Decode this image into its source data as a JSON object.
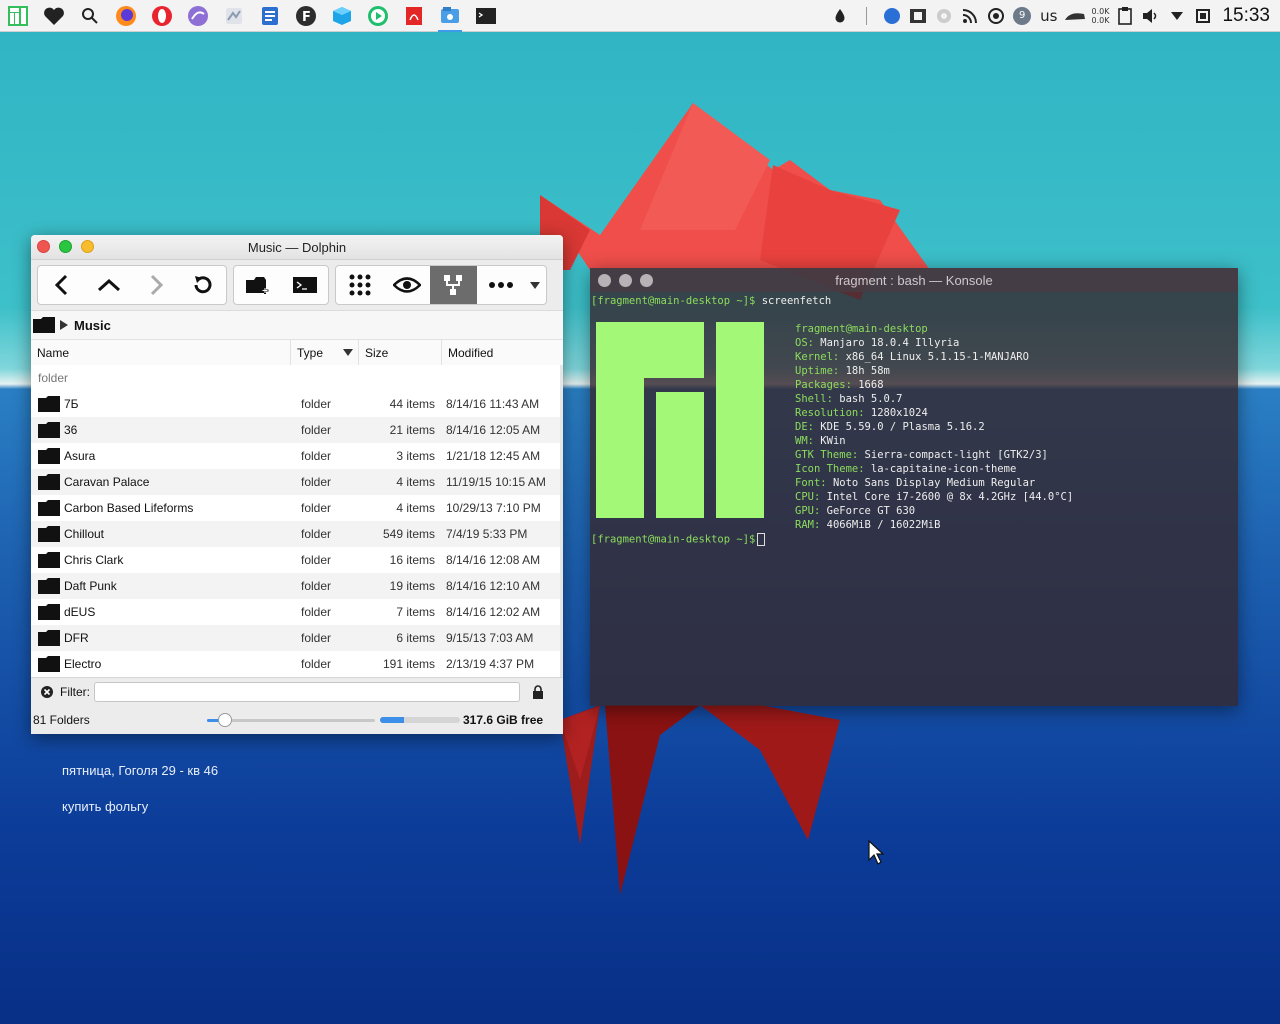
{
  "panel": {
    "launchers": [
      "manjaro-icon",
      "heart-icon",
      "search-icon",
      "firefox-icon",
      "opera-icon",
      "ferdi-icon",
      "gimp-icon",
      "document-viewer-icon",
      "font-icon",
      "box-icon",
      "media-player-icon",
      "pdf-icon",
      "dolphin-icon",
      "konsole-icon"
    ],
    "keyboard_layout": "us",
    "net_up": "0.0K",
    "net_down": "0.0K",
    "updates_badge": "9",
    "clock": "15:33"
  },
  "desktop_notes": [
    "пятница, Гоголя 29 - кв 46",
    "купить фольгу"
  ],
  "dolphin": {
    "title": "Music — Dolphin",
    "breadcrumb": "Music",
    "columns": {
      "name": "Name",
      "type": "Type",
      "size": "Size",
      "modified": "Modified"
    },
    "group_label": "folder",
    "rows": [
      {
        "name": "7Б",
        "type": "folder",
        "size": "44 items",
        "modified": "8/14/16 11:43 AM"
      },
      {
        "name": "36",
        "type": "folder",
        "size": "21 items",
        "modified": "8/14/16 12:05 AM"
      },
      {
        "name": "Asura",
        "type": "folder",
        "size": "3 items",
        "modified": "1/21/18 12:45 AM"
      },
      {
        "name": "Caravan Palace",
        "type": "folder",
        "size": "4 items",
        "modified": "11/19/15 10:15 AM"
      },
      {
        "name": "Carbon Based Lifeforms",
        "type": "folder",
        "size": "4 items",
        "modified": "10/29/13 7:10 PM"
      },
      {
        "name": "Chillout",
        "type": "folder",
        "size": "549 items",
        "modified": "7/4/19 5:33 PM"
      },
      {
        "name": "Chris Clark",
        "type": "folder",
        "size": "16 items",
        "modified": "8/14/16 12:08 AM"
      },
      {
        "name": "Daft Punk",
        "type": "folder",
        "size": "19 items",
        "modified": "8/14/16 12:10 AM"
      },
      {
        "name": "dEUS",
        "type": "folder",
        "size": "7 items",
        "modified": "8/14/16 12:02 AM"
      },
      {
        "name": "DFR",
        "type": "folder",
        "size": "6 items",
        "modified": "9/15/13 7:03 AM"
      },
      {
        "name": "Electro",
        "type": "folder",
        "size": "191 items",
        "modified": "2/13/19 4:37 PM"
      }
    ],
    "filter": {
      "label": "Filter:",
      "value": "",
      "placeholder": ""
    },
    "status": {
      "folder_count": "81 Folders",
      "free_space": "317.6 GiB free",
      "zoom_level": 0.08,
      "used_space_fraction": 0.3
    }
  },
  "konsole": {
    "title": "fragment : bash — Konsole",
    "prompt": "[fragment@main-desktop ~]$",
    "command": "screenfetch",
    "user_host": "fragment@main-desktop",
    "info": [
      {
        "key": "OS:",
        "value": "Manjaro 18.0.4 Illyria"
      },
      {
        "key": "Kernel:",
        "value": "x86_64 Linux 5.1.15-1-MANJARO"
      },
      {
        "key": "Uptime:",
        "value": "18h 58m"
      },
      {
        "key": "Packages:",
        "value": "1668"
      },
      {
        "key": "Shell:",
        "value": "bash 5.0.7"
      },
      {
        "key": "Resolution:",
        "value": "1280x1024"
      },
      {
        "key": "DE:",
        "value": "KDE 5.59.0 / Plasma 5.16.2"
      },
      {
        "key": "WM:",
        "value": "KWin"
      },
      {
        "key": "GTK Theme:",
        "value": "Sierra-compact-light [GTK2/3]"
      },
      {
        "key": "Icon Theme:",
        "value": "la-capitaine-icon-theme"
      },
      {
        "key": "Font:",
        "value": "Noto Sans Display Medium Regular"
      },
      {
        "key": "CPU:",
        "value": "Intel Core i7-2600 @ 8x 4.2GHz [44.0°C]"
      },
      {
        "key": "GPU:",
        "value": "GeForce GT 630"
      },
      {
        "key": "RAM:",
        "value": "4066MiB / 16022MiB"
      }
    ]
  },
  "colors": {
    "accent": "#3d8ee8",
    "terminal_green": "#8bdc5c",
    "manjaro_logo": "#a3f977",
    "iceberg_red": "#e8433f"
  }
}
